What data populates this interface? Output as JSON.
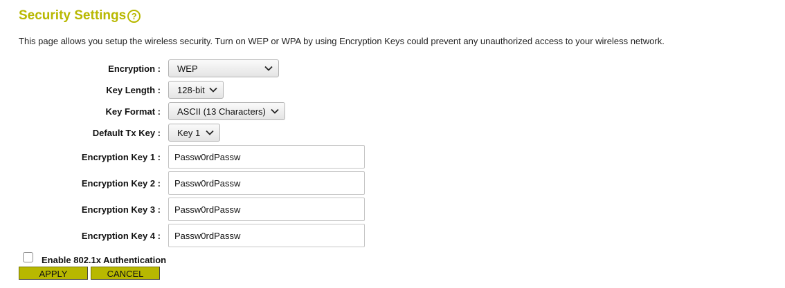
{
  "page": {
    "title": "Security Settings",
    "help_icon": "question-circle-icon",
    "description": "This page allows you setup the wireless security. Turn on WEP or WPA by using Encryption Keys could prevent any unauthorized access to your wireless network."
  },
  "form": {
    "encryption": {
      "label": "Encryption :",
      "value": "WEP"
    },
    "key_length": {
      "label": "Key Length :",
      "value": "128-bit"
    },
    "key_format": {
      "label": "Key Format :",
      "value": "ASCII (13 Characters)"
    },
    "default_tx_key": {
      "label": "Default Tx Key :",
      "value": "Key 1"
    },
    "keys": [
      {
        "label": "Encryption Key 1 :",
        "value": "Passw0rdPassw"
      },
      {
        "label": "Encryption Key 2 :",
        "value": "Passw0rdPassw"
      },
      {
        "label": "Encryption Key 3 :",
        "value": "Passw0rdPassw"
      },
      {
        "label": "Encryption Key 4 :",
        "value": "Passw0rdPassw"
      }
    ],
    "enable_8021x": {
      "label": "Enable 802.1x Authentication",
      "checked": false
    }
  },
  "buttons": {
    "apply": "APPLY",
    "cancel": "CANCEL"
  },
  "colors": {
    "accent": "#b8b800",
    "button_bg": "#b8b800"
  }
}
